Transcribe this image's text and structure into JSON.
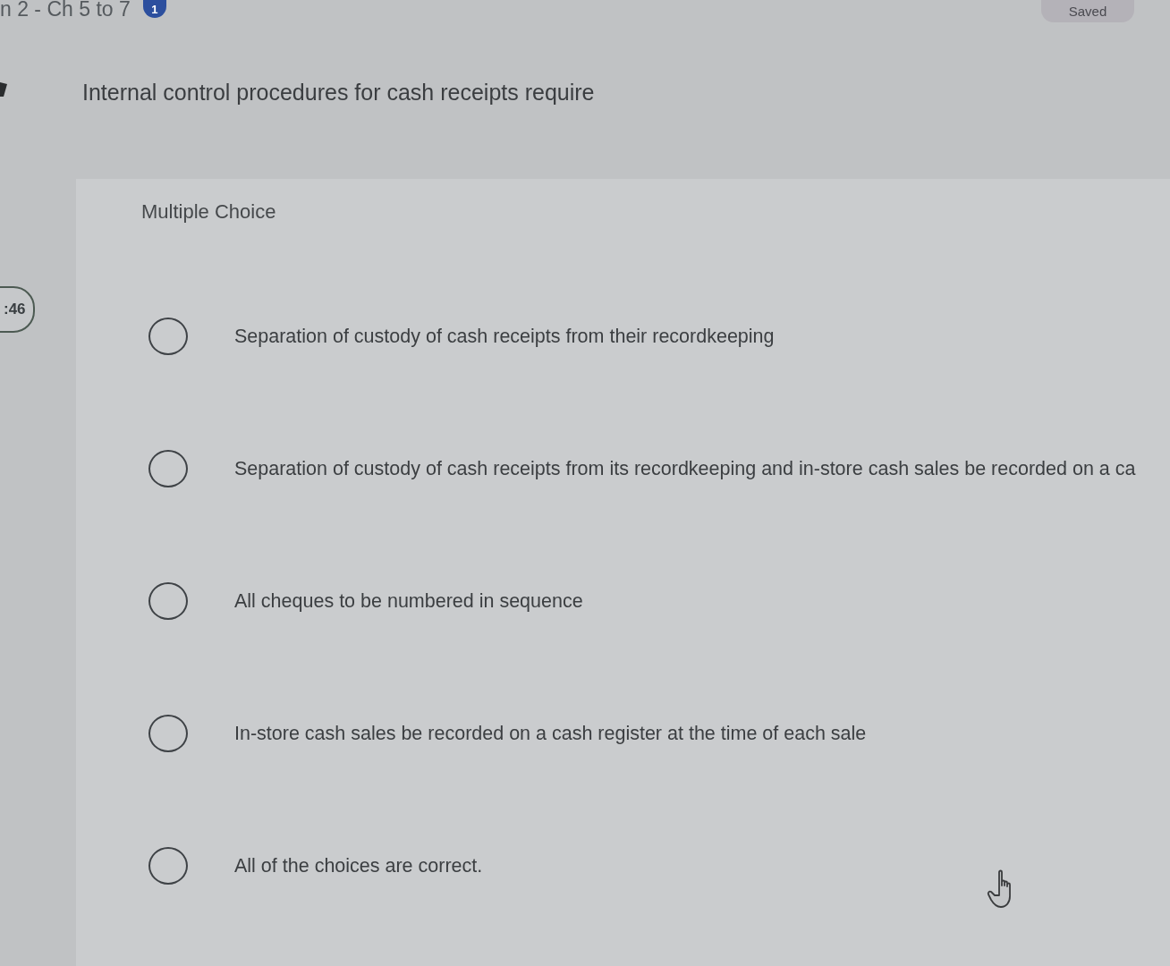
{
  "header": {
    "assignment_title": "n 2 - Ch 5 to 7",
    "badge": "1",
    "status": "Saved"
  },
  "timer": ":46",
  "question": {
    "prompt": "Internal control procedures for cash receipts require",
    "type_label": "Multiple Choice",
    "options": [
      {
        "text": "Separation of custody of cash receipts from their recordkeeping",
        "selected": false
      },
      {
        "text": "Separation of custody of cash receipts from its recordkeeping and in-store cash sales be recorded on a ca",
        "selected": false
      },
      {
        "text": "All cheques to be numbered in sequence",
        "selected": false
      },
      {
        "text": "In-store cash sales be recorded on a cash register at the time of each sale",
        "selected": false
      },
      {
        "text": "All of the choices are correct.",
        "selected": false
      }
    ]
  }
}
